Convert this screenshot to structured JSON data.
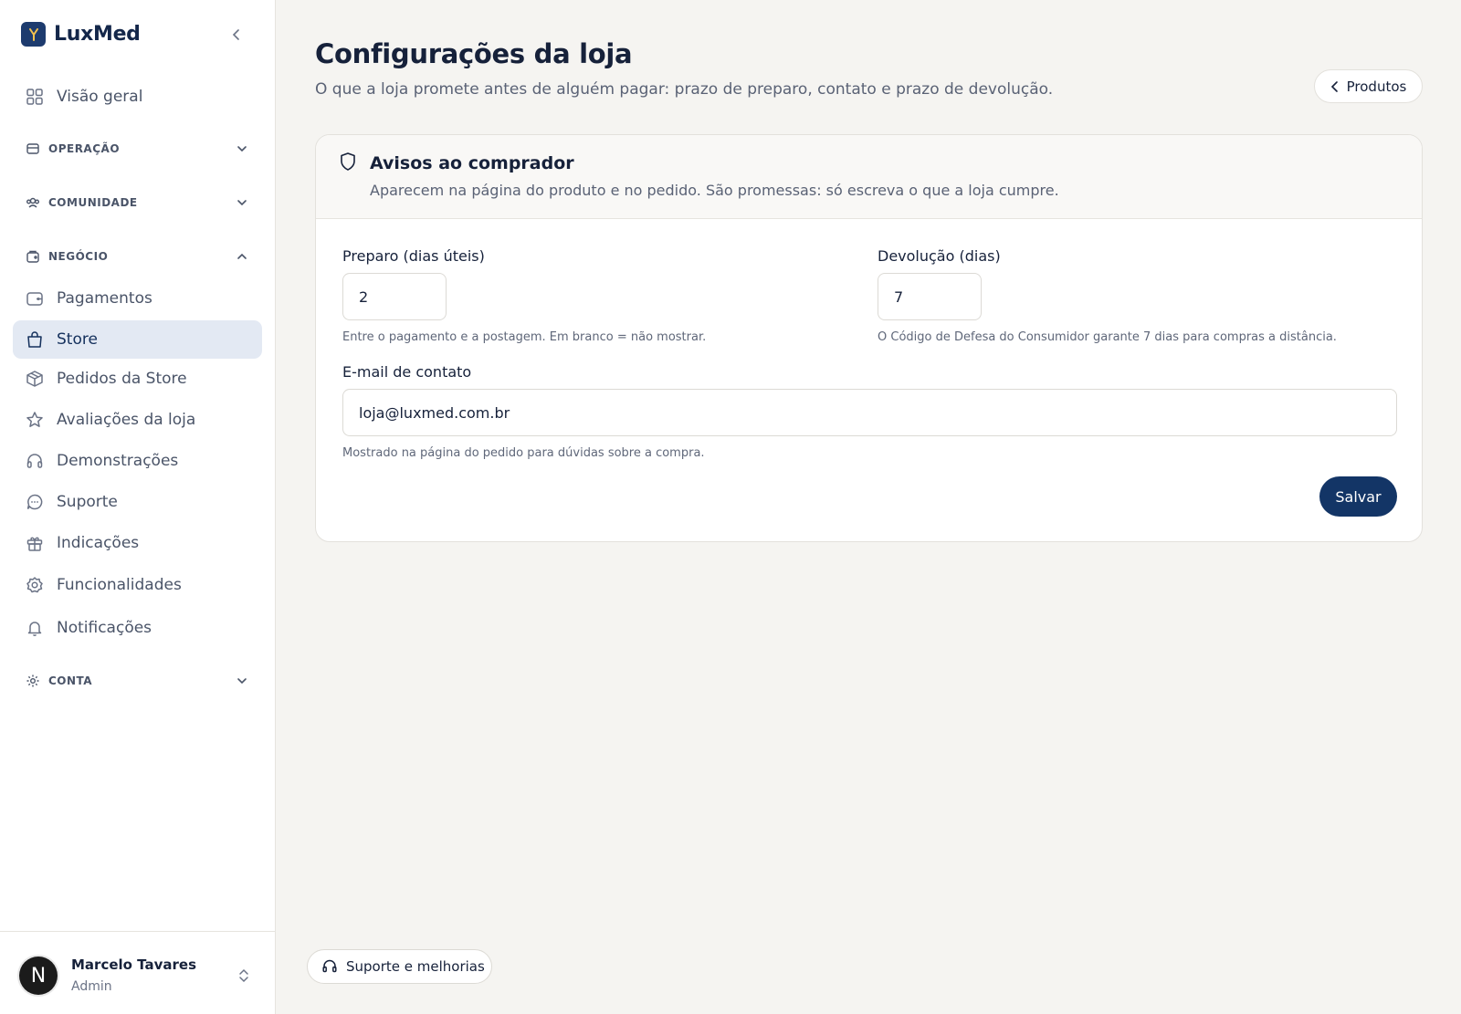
{
  "brand": {
    "name": "LuxMed"
  },
  "sidebar": {
    "overview": {
      "label": "Visão geral",
      "icon": "grid-icon"
    },
    "sections": [
      {
        "label": "OPERAÇÃO",
        "icon": "operation-icon",
        "expanded": false
      },
      {
        "label": "COMUNIDADE",
        "icon": "community-icon",
        "expanded": false
      },
      {
        "label": "NEGÓCIO",
        "icon": "business-icon",
        "expanded": true
      },
      {
        "label": "CONTA",
        "icon": "settings-icon",
        "expanded": false
      }
    ],
    "business_items": [
      {
        "label": "Pagamentos",
        "icon": "wallet-icon",
        "active": false
      },
      {
        "label": "Store",
        "icon": "shopping-bag-icon",
        "active": true
      },
      {
        "label": "Pedidos da Store",
        "icon": "package-icon",
        "active": false
      },
      {
        "label": "Avaliações da loja",
        "icon": "star-icon",
        "active": false
      },
      {
        "label": "Demonstrações",
        "icon": "headphones-icon",
        "active": false
      },
      {
        "label": "Suporte",
        "icon": "chat-icon",
        "active": false
      },
      {
        "label": "Indicações",
        "icon": "gift-icon",
        "active": false
      },
      {
        "label": "Funcionalidades",
        "icon": "gear-icon",
        "active": false
      },
      {
        "label": "Notificações",
        "icon": "bell-icon",
        "active": false
      }
    ],
    "user": {
      "initial": "N",
      "name": "Marcelo Tavares",
      "role": "Admin"
    }
  },
  "header": {
    "title": "Configurações da loja",
    "subtitle": "O que a loja promete antes de alguém pagar: prazo de preparo, contato e prazo de devolução.",
    "back_label": "Produtos"
  },
  "card": {
    "title": "Avisos ao comprador",
    "description": "Aparecem na página do produto e no pedido. São promessas: só escreva o que a loja cumpre.",
    "prep": {
      "label": "Preparo (dias úteis)",
      "value": "2",
      "hint": "Entre o pagamento e a postagem. Em branco = não mostrar."
    },
    "returns": {
      "label": "Devolução (dias)",
      "value": "7",
      "hint": "O Código de Defesa do Consumidor garante 7 dias para compras a distância."
    },
    "email": {
      "label": "E-mail de contato",
      "value": "loja@luxmed.com.br",
      "hint": "Mostrado na página do pedido para dúvidas sobre a compra."
    },
    "save_label": "Salvar"
  },
  "support_button": {
    "label": "Suporte e melhorias"
  },
  "colors": {
    "primary": "#133566",
    "active_bg": "#e3e9f3",
    "page_bg": "#f5f4f1"
  }
}
